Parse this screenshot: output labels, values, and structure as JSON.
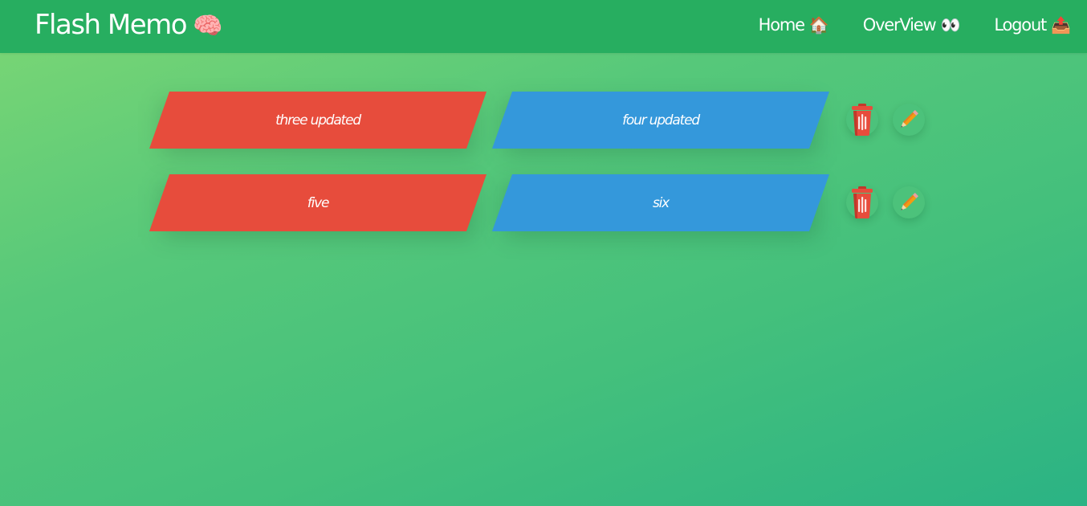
{
  "app": {
    "brand": "Flash Memo",
    "brand_emoji": "🧠"
  },
  "nav": {
    "items": [
      {
        "label": "Home",
        "emoji": "🏠"
      },
      {
        "label": "OverView",
        "emoji": "👀"
      },
      {
        "label": "Logout",
        "emoji": "📤"
      }
    ]
  },
  "cards": [
    {
      "front": "three updated",
      "back": "four updated"
    },
    {
      "front": "five",
      "back": "six"
    }
  ],
  "colors": {
    "navbar": "#27ae60",
    "front_card": "#e74c3c",
    "back_card": "#3498db",
    "delete_icon": "#e74c3c",
    "edit_icon": "#f39c12"
  },
  "icons": {
    "delete": "trash-icon",
    "edit": "pencil-icon"
  }
}
